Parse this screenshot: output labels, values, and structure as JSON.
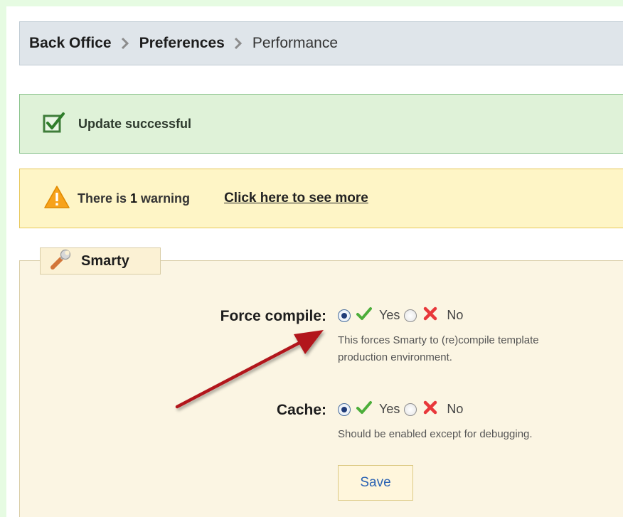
{
  "breadcrumb": {
    "items": [
      "Back Office",
      "Preferences",
      "Performance"
    ]
  },
  "success": {
    "icon": "checkbox-check-icon",
    "message": "Update successful"
  },
  "warning": {
    "icon": "warning-triangle-icon",
    "prefix": "There is ",
    "count": "1",
    "suffix": " warning",
    "link": "Click here to see more"
  },
  "smarty": {
    "legend": "Smarty",
    "legend_icon": "wrench-icon",
    "force_compile": {
      "label": "Force compile:",
      "selected": "Yes",
      "yes": "Yes",
      "no": "No",
      "hint": "This forces Smarty to (re)compile template",
      "hint2": "production environment."
    },
    "cache": {
      "label": "Cache:",
      "selected": "Yes",
      "yes": "Yes",
      "no": "No",
      "hint": "Should be enabled except for debugging."
    },
    "save_label": "Save"
  },
  "colors": {
    "page_background": "#e6fbe2",
    "success_background": "#dff2d8",
    "warning_background": "#fef5c6",
    "fieldset_background": "#fbf5e3",
    "save_text": "#2b63b3",
    "arrow": "#b2181c"
  }
}
